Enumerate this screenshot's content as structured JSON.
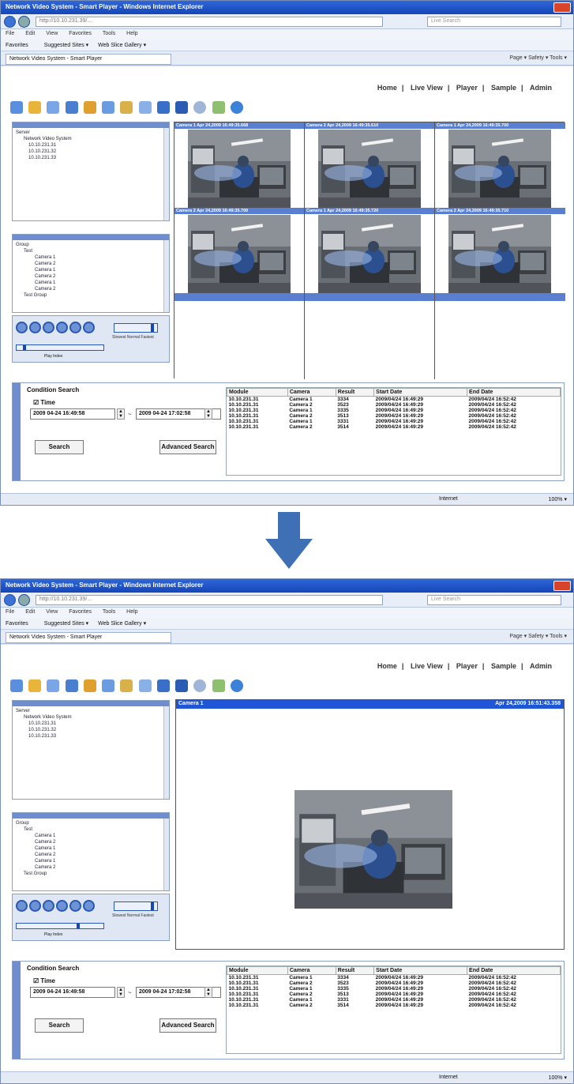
{
  "browser": {
    "window_title": "Network Video System - Smart Player - Windows Internet Explorer",
    "address": "http://10.10.231.39/...",
    "search_placeholder": "Live Search",
    "menu": [
      "File",
      "Edit",
      "View",
      "Favorites",
      "Tools",
      "Help"
    ],
    "favorites_label": "Favorites",
    "fav_items": [
      "Suggested Sites ▾",
      "Web Slice Gallery ▾"
    ],
    "tab_title": "Network Video System - Smart Player",
    "toolbar_right": "Page ▾  Safety ▾  Tools ▾",
    "status_zone": "Internet",
    "status_zoom": "100% ▾"
  },
  "nav": {
    "home": "Home",
    "live_view": "Live View",
    "player": "Player",
    "sample": "Sample",
    "admin": "Admin",
    "sep": "|"
  },
  "server_tree": [
    "Server",
    "Network Video System",
    "10.10.231.31",
    "10.10.231.32",
    "10.10.231.33"
  ],
  "group_tree": [
    "Group",
    "Test",
    "Camera 1",
    "Camera 2",
    "Camera 1",
    "Camera 2",
    "Camera 1",
    "Camera 2",
    "Test Group"
  ],
  "speed_label": "Slowest  Normal  Fastest",
  "index_label": "Play Index",
  "top_grid_captions": [
    "Camera 1  Apr 24,2009 16:49:35.668",
    "Camera 2  Apr 24,2009 16:49:35.610",
    "Camera 1  Apr 24,2009 16:49:35.700",
    "Camera 2  Apr 24,2009 16:49:35.700",
    "Camera 1  Apr 24,2009 16:49:35.720",
    "Camera 2  Apr 24,2009 16:49:35.710"
  ],
  "single_view": {
    "camera": "Camera 1",
    "timestamp": "Apr 24,2009 16:51:43.358"
  },
  "search": {
    "title": "Condition Search",
    "time_label": "Time",
    "from": "2009 04-24 16:49:58",
    "to": "2009 04-24 17:02:58",
    "dash": "~",
    "search_btn": "Search",
    "advanced_btn": "Advanced Search"
  },
  "results": {
    "headers": [
      "Module",
      "Camera",
      "Result",
      "Start Date",
      "End Date"
    ],
    "rows": [
      [
        "10.10.231.31",
        "Camera 1",
        "3334",
        "2009/04/24 16:49:29",
        "2009/04/24 16:52:42"
      ],
      [
        "10.10.231.31",
        "Camera 2",
        "3523",
        "2009/04/24 16:49:29",
        "2009/04/24 16:52:42"
      ],
      [
        "10.10.231.31",
        "Camera 1",
        "3335",
        "2009/04/24 16:49:29",
        "2009/04/24 16:52:42"
      ],
      [
        "10.10.231.31",
        "Camera 2",
        "3513",
        "2009/04/24 16:49:29",
        "2009/04/24 16:52:42"
      ],
      [
        "10.10.231.31",
        "Camera 1",
        "3331",
        "2009/04/24 16:49:29",
        "2009/04/24 16:52:42"
      ],
      [
        "10.10.231.31",
        "Camera 2",
        "3514",
        "2009/04/24 16:49:29",
        "2009/04/24 16:52:42"
      ]
    ]
  },
  "colors": {
    "accent": "#1546b8",
    "arrow": "#3f6fb5"
  }
}
